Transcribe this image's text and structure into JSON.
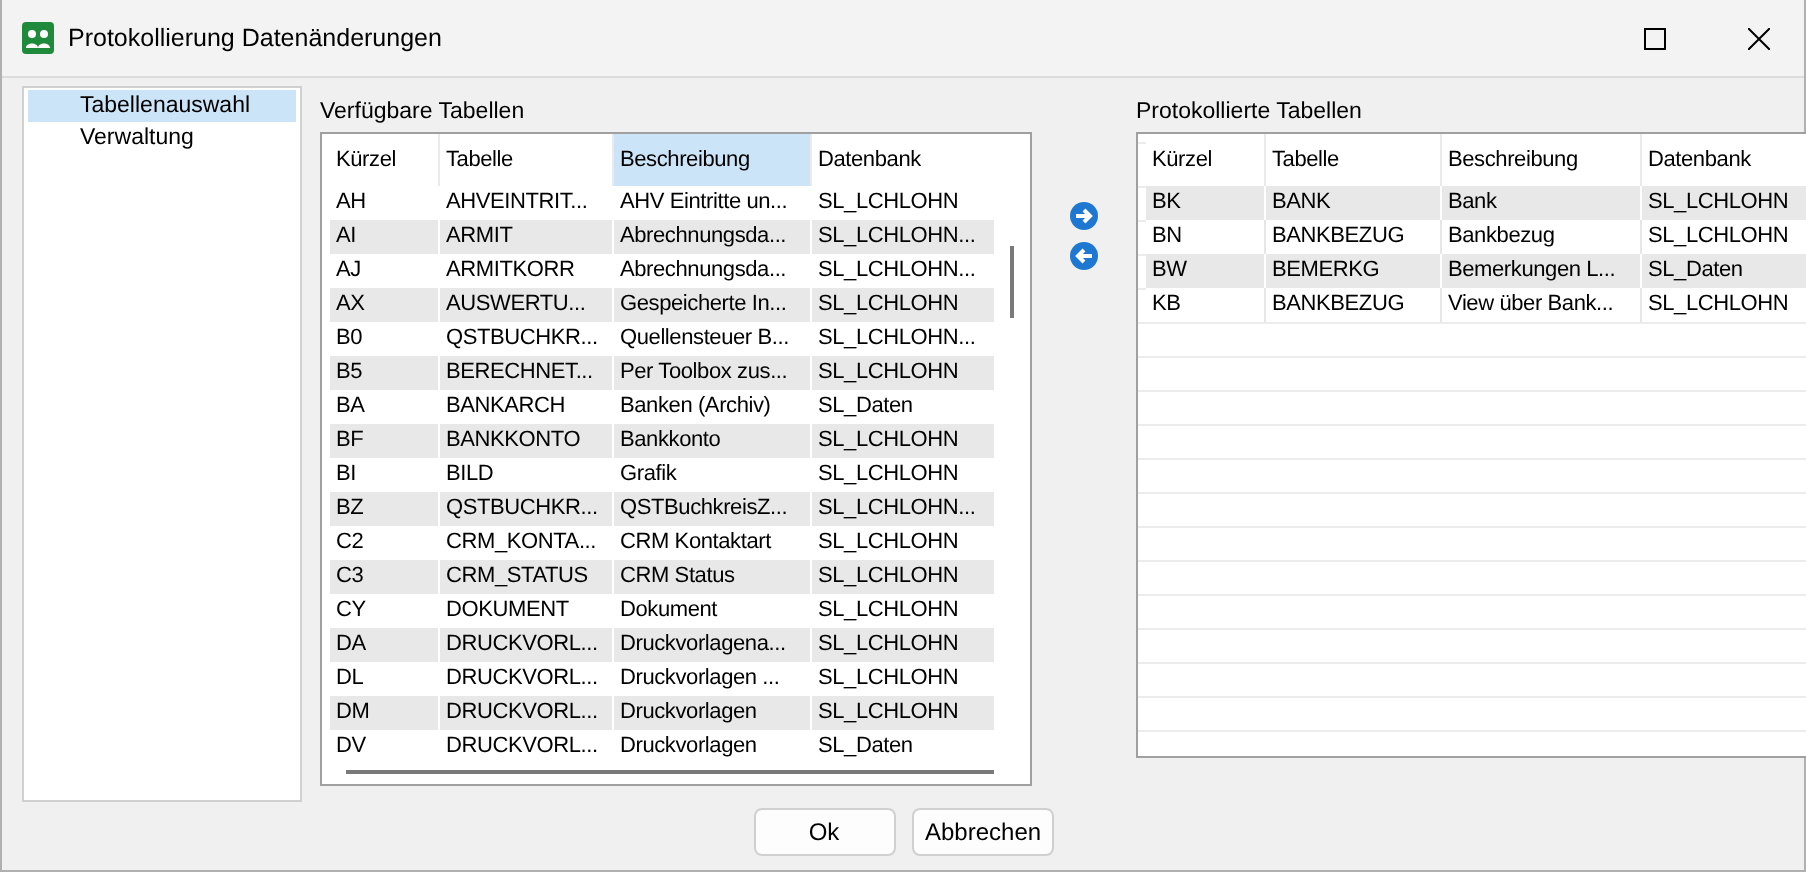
{
  "window": {
    "title": "Protokollierung Datenänderungen"
  },
  "sidebar": {
    "items": [
      {
        "label": "Tabellenauswahl",
        "selected": true
      },
      {
        "label": "Verwaltung",
        "selected": false
      }
    ]
  },
  "available": {
    "title": "Verfügbare Tabellen",
    "columns": [
      {
        "label": "Kürzel",
        "sorted": false
      },
      {
        "label": "Tabelle",
        "sorted": false
      },
      {
        "label": "Beschreibung",
        "sorted": true
      },
      {
        "label": "Datenbank",
        "sorted": false
      }
    ],
    "rows": [
      [
        "AH",
        "AHVEINTRIT...",
        "AHV Eintritte un...",
        "SL_LCHLOHN"
      ],
      [
        "AI",
        "ARMIT",
        "Abrechnungsda...",
        "SL_LCHLOHN..."
      ],
      [
        "AJ",
        "ARMITKORR",
        "Abrechnungsda...",
        "SL_LCHLOHN..."
      ],
      [
        "AX",
        "AUSWERTU...",
        "Gespeicherte In...",
        "SL_LCHLOHN"
      ],
      [
        "B0",
        "QSTBUCHKR...",
        "Quellensteuer B...",
        "SL_LCHLOHN..."
      ],
      [
        "B5",
        "BERECHNET...",
        "Per Toolbox zus...",
        "SL_LCHLOHN"
      ],
      [
        "BA",
        "BANKARCH",
        "Banken (Archiv)",
        "SL_Daten"
      ],
      [
        "BF",
        "BANKKONTO",
        "Bankkonto",
        "SL_LCHLOHN"
      ],
      [
        "BI",
        "BILD",
        "Grafik",
        "SL_LCHLOHN"
      ],
      [
        "BZ",
        "QSTBUCHKR...",
        "QSTBuchkreisZ...",
        "SL_LCHLOHN..."
      ],
      [
        "C2",
        "CRM_KONTA...",
        "CRM Kontaktart",
        "SL_LCHLOHN"
      ],
      [
        "C3",
        "CRM_STATUS",
        "CRM Status",
        "SL_LCHLOHN"
      ],
      [
        "CY",
        "DOKUMENT",
        "Dokument",
        "SL_LCHLOHN"
      ],
      [
        "DA",
        "DRUCKVORL...",
        "Druckvorlagena...",
        "SL_LCHLOHN"
      ],
      [
        "DL",
        "DRUCKVORL...",
        "Druckvorlagen ...",
        "SL_LCHLOHN"
      ],
      [
        "DM",
        "DRUCKVORL...",
        "Druckvorlagen",
        "SL_LCHLOHN"
      ],
      [
        "DV",
        "DRUCKVORL...",
        "Druckvorlagen",
        "SL_Daten"
      ]
    ]
  },
  "logged": {
    "title": "Protokollierte Tabellen",
    "columns": [
      {
        "label": "Kürzel",
        "sorted": false
      },
      {
        "label": "Tabelle",
        "sorted": false
      },
      {
        "label": "Beschreibung",
        "sorted": false
      },
      {
        "label": "Datenbank",
        "sorted": false
      }
    ],
    "rows": [
      [
        "BK",
        "BANK",
        "Bank",
        "SL_LCHLOHN"
      ],
      [
        "BN",
        "BANKBEZUG",
        "Bankbezug",
        "SL_LCHLOHN"
      ],
      [
        "BW",
        "BEMERKG",
        "Bemerkungen L...",
        "SL_Daten"
      ],
      [
        "KB",
        "BANKBEZUG",
        "View über Bank...",
        "SL_LCHLOHN"
      ]
    ]
  },
  "buttons": [
    "Ok",
    "Abbrechen"
  ]
}
